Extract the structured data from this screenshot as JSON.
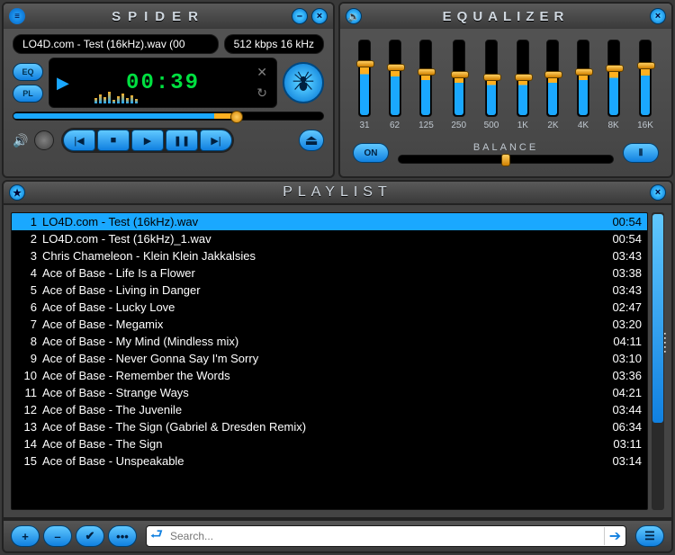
{
  "player": {
    "app_name": "SPIDER",
    "track_info": "LO4D.com - Test (16kHz).wav  (00",
    "bitrate_info": "512 kbps 16 kHz",
    "eq_label": "EQ",
    "pl_label": "PL",
    "time": "00:39",
    "seek_percent": 72,
    "icons": {
      "menu": "≡",
      "minimize": "–",
      "close": "×",
      "prev": "|◀",
      "stop": "■",
      "play": "▶",
      "pause": "❚❚",
      "next": "▶|",
      "eject": "⏏",
      "volume": "🔊",
      "shuffle": "✕",
      "repeat": "↻"
    }
  },
  "equalizer": {
    "title": "EQUALIZER",
    "sound_icon": "🔉",
    "close": "×",
    "on_label": "ON",
    "balance_label": "BALANCE",
    "presets_icon": "⫴",
    "bands": [
      {
        "label": "31",
        "value": 68
      },
      {
        "label": "62",
        "value": 64
      },
      {
        "label": "125",
        "value": 58
      },
      {
        "label": "250",
        "value": 54
      },
      {
        "label": "500",
        "value": 50
      },
      {
        "label": "1K",
        "value": 50
      },
      {
        "label": "2K",
        "value": 54
      },
      {
        "label": "4K",
        "value": 58
      },
      {
        "label": "8K",
        "value": 62
      },
      {
        "label": "16K",
        "value": 66
      }
    ]
  },
  "playlist": {
    "title": "PLAYLIST",
    "star": "★",
    "close": "×",
    "selected_index": 0,
    "tracks": [
      {
        "n": 1,
        "name": "LO4D.com - Test (16kHz).wav",
        "dur": "00:54"
      },
      {
        "n": 2,
        "name": "LO4D.com - Test (16kHz)_1.wav",
        "dur": "00:54"
      },
      {
        "n": 3,
        "name": "Chris Chameleon - Klein Klein Jakkalsies",
        "dur": "03:43"
      },
      {
        "n": 4,
        "name": "Ace of Base - Life Is a Flower",
        "dur": "03:38"
      },
      {
        "n": 5,
        "name": "Ace of Base - Living in Danger",
        "dur": "03:43"
      },
      {
        "n": 6,
        "name": "Ace of Base - Lucky Love",
        "dur": "02:47"
      },
      {
        "n": 7,
        "name": "Ace of Base - Megamix",
        "dur": "03:20"
      },
      {
        "n": 8,
        "name": "Ace of Base - My Mind (Mindless mix)",
        "dur": "04:11"
      },
      {
        "n": 9,
        "name": "Ace of Base - Never Gonna Say I'm Sorry",
        "dur": "03:10"
      },
      {
        "n": 10,
        "name": "Ace of Base - Remember the Words",
        "dur": "03:36"
      },
      {
        "n": 11,
        "name": "Ace of Base - Strange Ways",
        "dur": "04:21"
      },
      {
        "n": 12,
        "name": "Ace of Base - The Juvenile",
        "dur": "03:44"
      },
      {
        "n": 13,
        "name": "Ace of Base - The Sign (Gabriel & Dresden Remix)",
        "dur": "06:34"
      },
      {
        "n": 14,
        "name": "Ace of Base - The Sign",
        "dur": "03:11"
      },
      {
        "n": 15,
        "name": "Ace of Base - Unspeakable",
        "dur": "03:14"
      }
    ],
    "footer": {
      "add": "+",
      "remove": "–",
      "check": "✔",
      "more": "•••",
      "back": "⮐",
      "go": "➔",
      "list": "☰",
      "search_placeholder": "Search..."
    }
  },
  "colors": {
    "accent": "#1aa8ff",
    "amber": "#ffb020",
    "green": "#00e040"
  }
}
